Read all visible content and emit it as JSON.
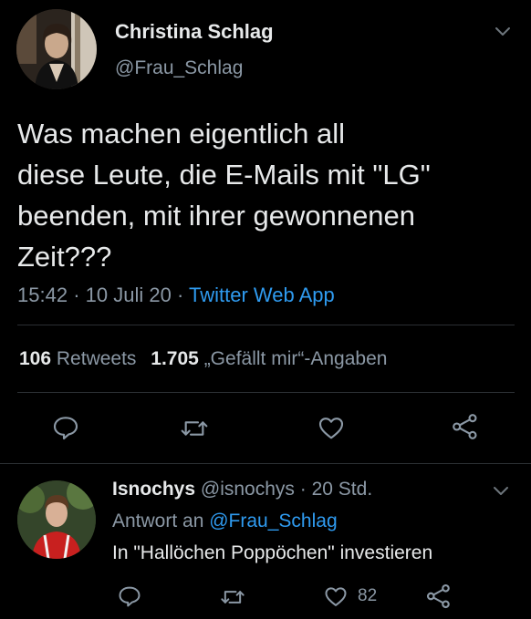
{
  "tweet": {
    "author_name": "Christina Schlag",
    "author_handle": "@Frau_Schlag",
    "text_lines": [
      "Was machen eigentlich all",
      "diese Leute, die E-Mails mit \"LG\"",
      "beenden, mit ihrer gewonnenen",
      "Zeit???"
    ],
    "time": "15:42",
    "sep1": "·",
    "date": "10 Juli 20",
    "sep2": "·",
    "source": "Twitter Web App",
    "retweets_count": "106",
    "retweets_label": "Retweets",
    "likes_count": "1.705",
    "likes_label": "„Gefällt mir“-Angaben"
  },
  "reply": {
    "author_name": "Isnochys",
    "author_handle": "@isnochys",
    "sep": "·",
    "age": "20 Std.",
    "reply_prefix": "Antwort an",
    "reply_to": "@Frau_Schlag",
    "text": "In \"Hallöchen Poppöchen\" investieren",
    "like_count": "82"
  },
  "colors": {
    "background": "#000000",
    "text": "#e7e9ea",
    "muted": "#8b98a5",
    "link": "#2f9bf0",
    "divider": "#2b2f33"
  },
  "icons": [
    "chevron-down-icon",
    "reply-icon",
    "retweet-icon",
    "like-icon",
    "share-icon"
  ]
}
